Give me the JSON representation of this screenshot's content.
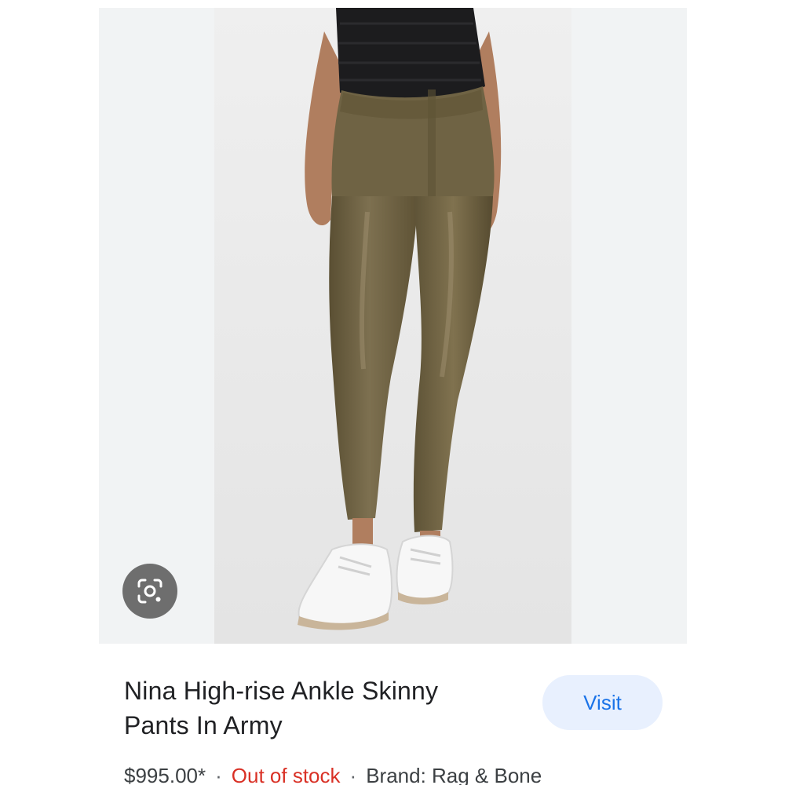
{
  "product": {
    "title": "Nina High-rise Ankle Skinny Pants In Army",
    "price": "$995.00*",
    "separator": "·",
    "stock_status": "Out of stock",
    "brand": "Brand: Rag & Bone",
    "visit_label": "Visit",
    "image_subject": "olive leather skinny pants worn with black sweater and white sneakers",
    "lens_icon": "lens-search-icon"
  },
  "colors": {
    "visit_text": "#1a73e8",
    "visit_background": "#e8f0fe",
    "stock_status": "#d93025",
    "pants": "#6b5e3e"
  }
}
